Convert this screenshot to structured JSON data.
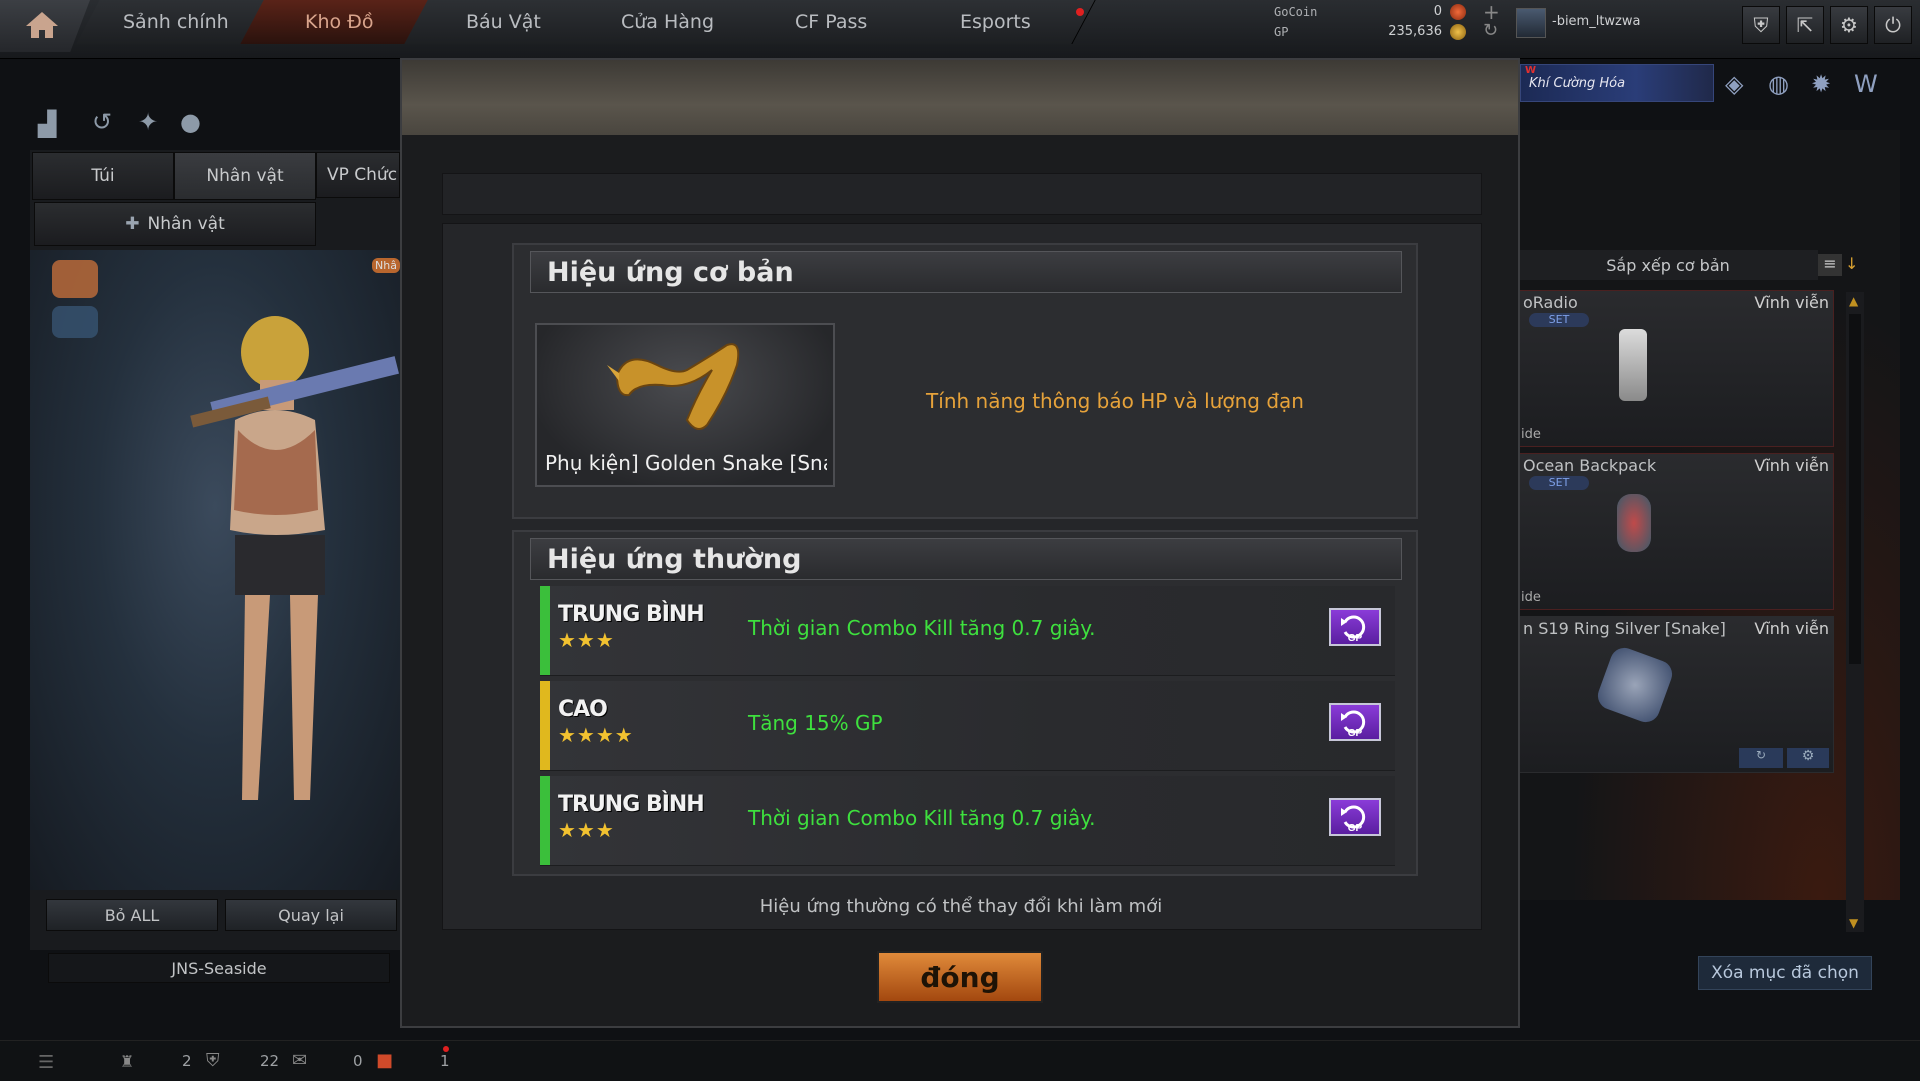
{
  "nav": {
    "tabs": [
      "Sảnh chính",
      "Kho Đồ",
      "Báu Vật",
      "Cửa Hàng",
      "CF Pass",
      "Esports"
    ],
    "active_tab": "Kho Đồ"
  },
  "currency": {
    "gocoin_label": "GoCoin",
    "gocoin_value": "0",
    "gp_label": "GP",
    "gp_value": "235,636"
  },
  "user": {
    "name": "-biem_ltwzwa"
  },
  "banner": {
    "text": "Khí Cường Hóa",
    "badge": "W"
  },
  "left": {
    "tabs": [
      "Túi",
      "Nhân vật",
      "VP Chức"
    ],
    "subtab": "Nhân vật",
    "side_badge": "Nhâ",
    "btn_remove_all": "Bỏ ALL",
    "btn_back": "Quay lại",
    "map_name": "JNS-Seaside"
  },
  "right": {
    "sort_label": "Sắp xếp cơ bản",
    "items": [
      {
        "name": "oRadio",
        "duration": "Vĩnh viễn",
        "set": "SET",
        "foot": "ide"
      },
      {
        "name": "Ocean Backpack",
        "duration": "Vĩnh viễn",
        "set": "SET",
        "foot": "ide"
      },
      {
        "name": "n S19 Ring Silver [Snake]",
        "duration": "Vĩnh viễn"
      }
    ],
    "clear_selected": "Xóa mục đã chọn"
  },
  "bottom": {
    "v1": "2",
    "v2": "22",
    "v3": "0",
    "v4": "1"
  },
  "modal": {
    "basic_title": "Hiệu ứng cơ bản",
    "item_name": "Phụ kiện] Golden Snake [Snake]",
    "basic_effect": "Tính năng thông báo HP và lượng đạn",
    "normal_title": "Hiệu ứng thường",
    "effects": [
      {
        "tier": "TRUNG BÌNH",
        "stars": "★★★",
        "text": "Thời gian Combo Kill tăng 0.7 giây.",
        "color": "#3bbf3b"
      },
      {
        "tier": "CAO",
        "stars": "★★★★",
        "text": "Tăng 15% GP",
        "color": "#e0b81e"
      },
      {
        "tier": "TRUNG BÌNH",
        "stars": "★★★",
        "text": "Thời gian Combo Kill tăng 0.7 giây.",
        "color": "#3bbf3b"
      }
    ],
    "note": "Hiệu ứng thường có thể thay đổi khi làm mới",
    "close_label": "đóng"
  }
}
